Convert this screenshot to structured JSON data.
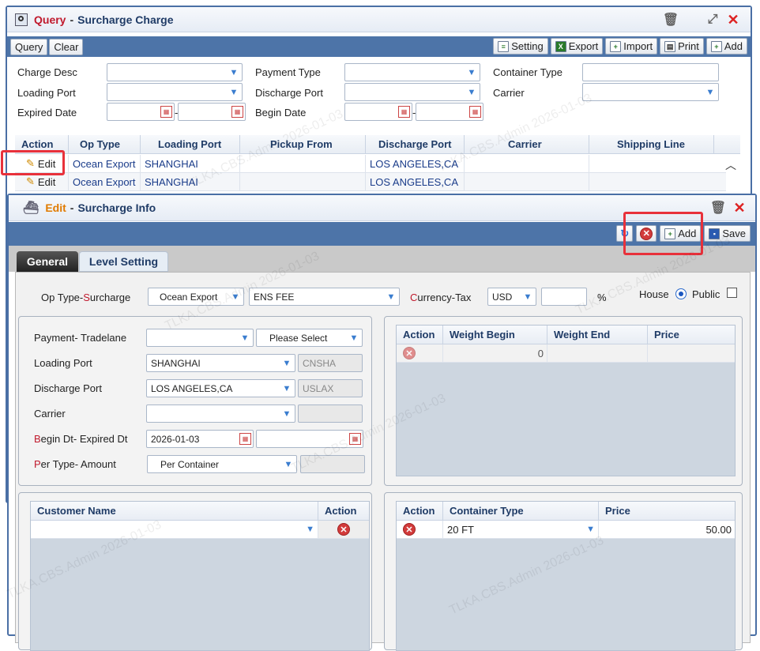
{
  "query": {
    "title_a": "Query",
    "title_sep": "-",
    "title_b": "Surcharge Charge",
    "buttons": {
      "query": "Query",
      "clear": "Clear",
      "setting": "Setting",
      "export": "Export",
      "import": "Import",
      "print": "Print",
      "add": "Add"
    },
    "fields": {
      "charge_desc": "Charge Desc",
      "payment_type": "Payment Type",
      "container_type": "Container Type",
      "loading_port": "Loading Port",
      "discharge_port": "Discharge Port",
      "carrier": "Carrier",
      "expired_date": "Expired Date",
      "begin_date": "Begin Date",
      "dash": "-"
    },
    "columns": [
      "Action",
      "Op Type",
      "Loading Port",
      "Pickup From",
      "Discharge Port",
      "Carrier",
      "Shipping Line"
    ],
    "rows": [
      {
        "action": "Edit",
        "op": "Ocean Export",
        "load": "SHANGHAI",
        "pickup": "",
        "discharge": "LOS ANGELES,CA",
        "carrier": "",
        "line": ""
      },
      {
        "action": "Edit",
        "op": "Ocean Export",
        "load": "SHANGHAI",
        "pickup": "",
        "discharge": "LOS ANGELES,CA",
        "carrier": "",
        "line": ""
      }
    ]
  },
  "edit": {
    "title_a": "Edit",
    "title_sep": "-",
    "title_b": "Surcharge Info",
    "buttons": {
      "add": "Add",
      "save": "Save"
    },
    "tabs": {
      "general": "General",
      "level": "Level Setting"
    },
    "op_type_label_1": "Op Type",
    "op_type_label_2": "S",
    "op_type_label_3": "urcharge",
    "op_type": "Ocean Export",
    "surcharge": "ENS FEE",
    "currency_label_1": "C",
    "currency_label_2": "urrency",
    "currency_label_3": "Tax",
    "currency": "USD",
    "tax": "",
    "percent": "%",
    "house": "House",
    "public": "Public",
    "payment_label": "Payment",
    "tradelane_label": "Tradelane",
    "tradelane": "Please Select",
    "loading_label": "Loading Port",
    "loading": "SHANGHAI",
    "loading_code": "CNSHA",
    "discharge_label": "Discharge Port",
    "discharge": "LOS ANGELES,CA",
    "discharge_code": "USLAX",
    "carrier_label": "Carrier",
    "begin_label_1": "B",
    "begin_label_2": "egin Dt",
    "expired_label": "Expired Dt",
    "begin_dt": "2026-01-03",
    "per_label_1": "P",
    "per_label_2": "er Type",
    "amount_label": "Amount",
    "per_type": "Per Container",
    "weight_cols": [
      "Action",
      "Weight Begin",
      "Weight End",
      "Price"
    ],
    "weight_row": {
      "begin": "0",
      "end": "",
      "price": ""
    },
    "customer_cols": [
      "Customer Name",
      "Action"
    ],
    "container_cols": [
      "Action",
      "Container Type",
      "Price"
    ],
    "container_row": {
      "type": "20 FT",
      "price": "50.00"
    }
  },
  "watermark": "TLKA.CBS.Admin 2026-01-03",
  "colors": {
    "accent": "#4d74a8",
    "highlight": "#e8313b"
  }
}
